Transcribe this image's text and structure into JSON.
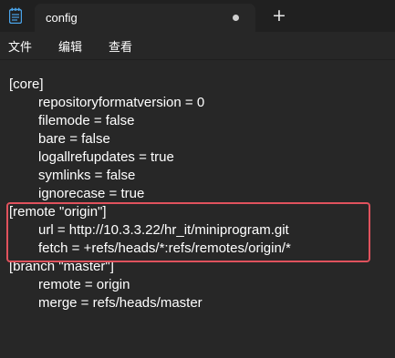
{
  "tab": {
    "title": "config",
    "unsaved_indicator": "dot",
    "new_tab_symbol": "+"
  },
  "app_icon": "notepad-icon",
  "menu": {
    "file": "文件",
    "edit": "编辑",
    "view": "查看"
  },
  "editor": {
    "lines": [
      "[core]",
      "repositoryformatversion = 0",
      "filemode = false",
      "bare = false",
      "logallrefupdates = true",
      "symlinks = false",
      "ignorecase = true",
      "[remote \"origin\"]",
      "url = http://10.3.3.22/hr_it/miniprogram.git",
      "fetch = +refs/heads/*:refs/remotes/origin/*",
      "[branch \"master\"]",
      "remote = origin",
      "merge = refs/heads/master"
    ]
  },
  "colors": {
    "background": "#272727",
    "titlebar": "#202020",
    "highlight": "#e0525d",
    "text": "#ffffff"
  }
}
